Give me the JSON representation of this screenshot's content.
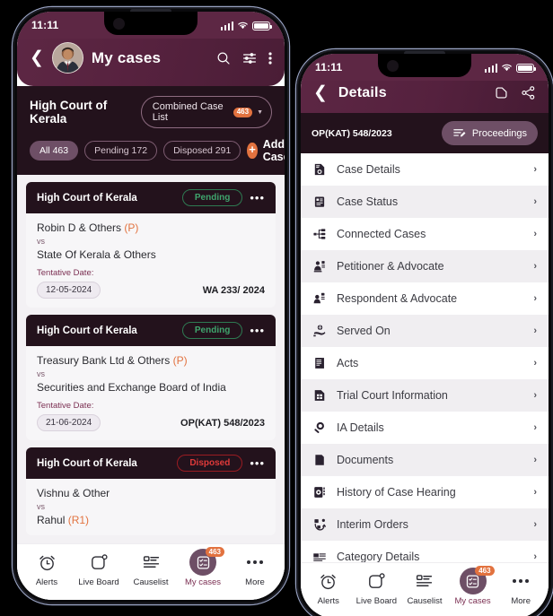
{
  "colors": {
    "header_maroon": "#5d2744",
    "dark_plum": "#23121c",
    "accent_orange": "#e2723f",
    "purple": "#6e4f66",
    "green_pending": "#3fa56d",
    "red_disposed": "#e03a3a"
  },
  "phone_left": {
    "statusbar": {
      "time": "11:11"
    },
    "header": {
      "back_icon": "chevron-left-icon",
      "avatar": "user-avatar",
      "title": "My cases",
      "search_icon": "search-icon",
      "filter_icon": "filter-sliders-icon",
      "menu_icon": "more-vertical-icon"
    },
    "subheader": {
      "court_name": "High Court of Kerala",
      "combined_label": "Combined Case List",
      "combined_count": "463",
      "caret_icon": "chevron-down-icon"
    },
    "filters": {
      "chips": [
        {
          "label": "All 463",
          "active": true
        },
        {
          "label": "Pending 172",
          "active": false
        },
        {
          "label": "Disposed 291",
          "active": false
        }
      ],
      "add_case_label": "Add Case",
      "add_case_icon": "plus-icon"
    },
    "cases": [
      {
        "court": "High Court of Kerala",
        "status": "Pending",
        "status_kind": "pending",
        "petitioner": "Robin D & Others",
        "petitioner_tag": "(P)",
        "vs": "vs",
        "respondent": "State Of Kerala & Others",
        "respondent_tag": "",
        "tentative_label": "Tentative Date:",
        "date": "12-05-2024",
        "case_no": "WA 233/ 2024",
        "menu_icon": "more-horizontal-icon"
      },
      {
        "court": "High Court of Kerala",
        "status": "Pending",
        "status_kind": "pending",
        "petitioner": "Treasury Bank Ltd & Others",
        "petitioner_tag": "(P)",
        "vs": "vs",
        "respondent": "Securities and Exchange Board of India",
        "respondent_tag": "",
        "tentative_label": "Tentative Date:",
        "date": "21-06-2024",
        "case_no": "OP(KAT) 548/2023",
        "menu_icon": "more-horizontal-icon"
      },
      {
        "court": "High Court of Kerala",
        "status": "Disposed",
        "status_kind": "disposed",
        "petitioner": "Vishnu & Other",
        "petitioner_tag": "",
        "vs": "vs",
        "respondent": "Rahul",
        "respondent_tag": "(R1)",
        "tentative_label": "",
        "date": "",
        "case_no": "",
        "menu_icon": "more-horizontal-icon"
      }
    ],
    "bottomnav": [
      {
        "label": "Alerts",
        "icon": "alarm-clock-icon",
        "active": false,
        "badge": ""
      },
      {
        "label": "Live Board",
        "icon": "live-board-icon",
        "active": false,
        "badge": ""
      },
      {
        "label": "Causelist",
        "icon": "causelist-icon",
        "active": false,
        "badge": ""
      },
      {
        "label": "My cases",
        "icon": "my-cases-icon",
        "active": true,
        "badge": "463"
      },
      {
        "label": "More",
        "icon": "more-dots-icon",
        "active": false,
        "badge": ""
      }
    ]
  },
  "phone_right": {
    "statusbar": {
      "time": "11:11"
    },
    "header": {
      "back_icon": "chevron-left-icon",
      "title": "Details",
      "copy_icon": "copy-icon",
      "share_icon": "share-icon"
    },
    "caseno_bar": {
      "case_no": "OP(KAT) 548/2023",
      "proceedings_label": "Proceedings",
      "proceedings_icon": "edit-list-icon"
    },
    "detail_rows": [
      {
        "label": "Case Details",
        "icon": "case-details-icon"
      },
      {
        "label": "Case Status",
        "icon": "case-status-icon"
      },
      {
        "label": "Connected Cases",
        "icon": "connected-cases-icon"
      },
      {
        "label": "Petitioner & Advocate",
        "icon": "petitioner-icon"
      },
      {
        "label": "Respondent & Advocate",
        "icon": "respondent-icon"
      },
      {
        "label": "Served On",
        "icon": "served-on-icon"
      },
      {
        "label": "Acts",
        "icon": "acts-icon"
      },
      {
        "label": "Trial Court Information",
        "icon": "trial-court-icon"
      },
      {
        "label": "IA Details",
        "icon": "ia-details-icon"
      },
      {
        "label": "Documents",
        "icon": "documents-icon"
      },
      {
        "label": "History of Case Hearing",
        "icon": "history-icon"
      },
      {
        "label": "Interim Orders",
        "icon": "interim-orders-icon"
      },
      {
        "label": "Category Details",
        "icon": "category-icon"
      }
    ],
    "row_chevron": "›",
    "bottomnav": [
      {
        "label": "Alerts",
        "icon": "alarm-clock-icon",
        "active": false,
        "badge": ""
      },
      {
        "label": "Live Board",
        "icon": "live-board-icon",
        "active": false,
        "badge": ""
      },
      {
        "label": "Causelist",
        "icon": "causelist-icon",
        "active": false,
        "badge": ""
      },
      {
        "label": "My cases",
        "icon": "my-cases-icon",
        "active": true,
        "badge": "463"
      },
      {
        "label": "More",
        "icon": "more-dots-icon",
        "active": false,
        "badge": ""
      }
    ]
  }
}
